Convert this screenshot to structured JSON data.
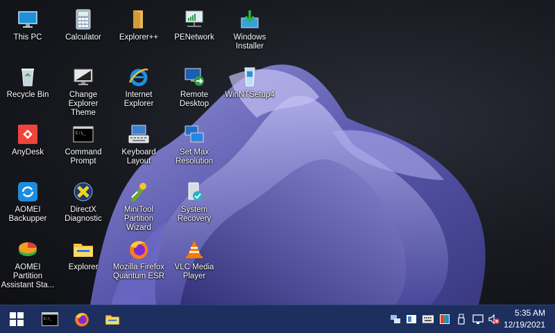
{
  "desktop_icons": [
    {
      "label": "This PC",
      "icon": "monitor-icon"
    },
    {
      "label": "Calculator",
      "icon": "calculator-icon"
    },
    {
      "label": "Explorer++",
      "icon": "folder-icon"
    },
    {
      "label": "PENetwork",
      "icon": "network-icon"
    },
    {
      "label": "Windows Installer",
      "icon": "installer-icon"
    },
    {
      "label": "Recycle Bin",
      "icon": "recycle-bin-icon"
    },
    {
      "label": "Change Explorer Theme",
      "icon": "theme-monitor-icon"
    },
    {
      "label": "Internet Explorer",
      "icon": "internet-explorer-icon"
    },
    {
      "label": "Remote Desktop",
      "icon": "remote-desktop-icon"
    },
    {
      "label": "WinNTSetup4",
      "icon": "setup-icon"
    },
    {
      "label": "AnyDesk",
      "icon": "anydesk-icon"
    },
    {
      "label": "Command Prompt",
      "icon": "command-prompt-icon"
    },
    {
      "label": "Keyboard Layout",
      "icon": "keyboard-icon"
    },
    {
      "label": "Set Max Resolution",
      "icon": "resolution-icon"
    },
    {
      "label": "AOMEI Backupper",
      "icon": "backup-icon"
    },
    {
      "label": "DirectX Diagnostic",
      "icon": "directx-icon"
    },
    {
      "label": "MiniTool Partition Wizard",
      "icon": "partition-wizard-icon"
    },
    {
      "label": "System Recovery",
      "icon": "system-recovery-icon"
    },
    {
      "label": "AOMEI Partition Assistant Sta...",
      "icon": "partition-assistant-icon"
    },
    {
      "label": "Explorer",
      "icon": "explorer-folder-icon"
    },
    {
      "label": "Mozilla Firefox Quantum ESR",
      "icon": "firefox-icon"
    },
    {
      "label": "VLC Media Player",
      "icon": "vlc-icon"
    }
  ],
  "taskbar": {
    "start_icon": "windows-logo-icon",
    "pinned": [
      "command-prompt-icon",
      "firefox-icon",
      "explorer-folder-icon"
    ],
    "tray_icons": [
      "network-icon",
      "notification-icon",
      "keyboard-icon",
      "display-icon",
      "usb-icon",
      "monitor-icon",
      "volume-muted-icon"
    ],
    "clock_time": "5:35 AM",
    "clock_date": "12/19/2021",
    "color": "#1d2f5f"
  }
}
